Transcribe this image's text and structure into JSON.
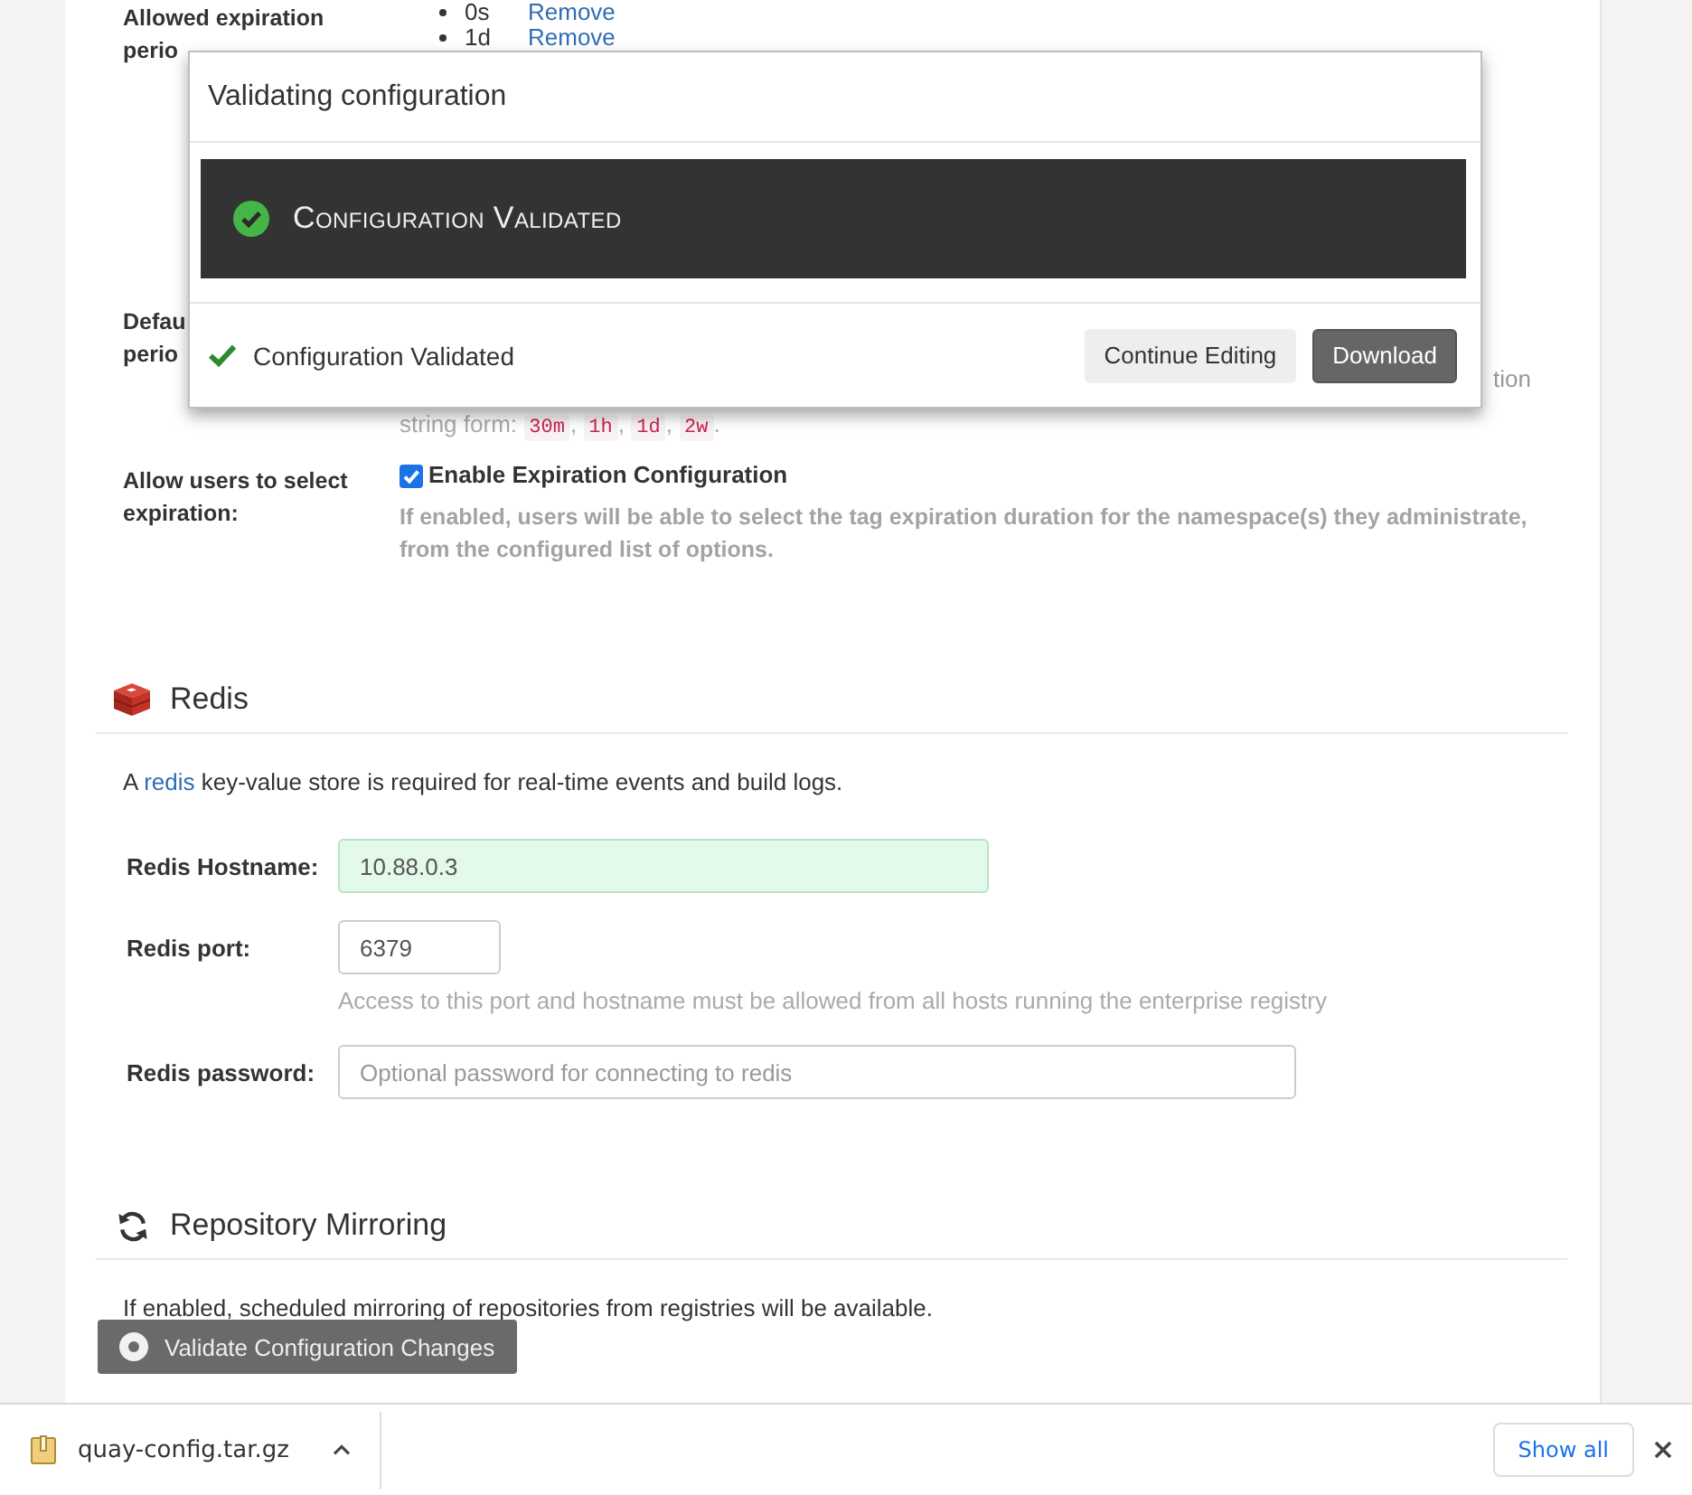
{
  "expiration_settings": {
    "rows": [
      {
        "kind": "list",
        "label_lines": [
          "Allowed expiration",
          "perio"
        ],
        "items": [
          {
            "value": "0s",
            "action": "Remove"
          },
          {
            "value": "1d",
            "action": "Remove"
          }
        ]
      },
      {
        "kind": "hint",
        "label_lines": [
          "Defau",
          "perio"
        ],
        "help_tail": "tion",
        "example": [
          {
            "kind": "plain",
            "text": "string form: "
          },
          {
            "kind": "code",
            "text": "30m"
          },
          {
            "kind": "plain",
            "text": ", "
          },
          {
            "kind": "code",
            "text": "1h"
          },
          {
            "kind": "plain",
            "text": ", "
          },
          {
            "kind": "code",
            "text": "1d"
          },
          {
            "kind": "plain",
            "text": ", "
          },
          {
            "kind": "code",
            "text": "2w"
          },
          {
            "kind": "plain",
            "text": "."
          }
        ]
      },
      {
        "kind": "checkbox",
        "label_lines": [
          "Allow users to select",
          "expiration:"
        ],
        "checkbox": {
          "label": "Enable Expiration Configuration",
          "checked": true
        },
        "help": "If enabled, users will be able to select the tag expiration duration for the namespace(s) they administrate, from the configured list of options."
      }
    ]
  },
  "redis": {
    "title": "Redis",
    "description": {
      "before": "A ",
      "link": "redis",
      "after": " key-value store is required for real-time events and build logs."
    },
    "fields": [
      {
        "label": "Redis Hostname:",
        "value": "10.88.0.3",
        "valid": true
      },
      {
        "label": "Redis port:",
        "value": "6379",
        "valid": false,
        "help": "Access to this port and hostname must be allowed from all hosts running the enterprise registry"
      },
      {
        "label": "Redis password:",
        "placeholder": "Optional password for connecting to redis",
        "valid": false
      }
    ]
  },
  "repository_mirroring": {
    "title": "Repository Mirroring",
    "description": "If enabled, scheduled mirroring of repositories from registries will be available."
  },
  "validate_button": {
    "label": "Validate Configuration Changes"
  },
  "modal": {
    "title": "Validating configuration",
    "validated": true,
    "banner": "Configuration Validated",
    "status": "Configuration Validated",
    "buttons": [
      {
        "label": "Continue Editing",
        "kind": "secondary"
      },
      {
        "label": "Download",
        "kind": "primary"
      }
    ]
  },
  "download_bar": {
    "file_name": "quay-config.tar.gz",
    "show_all": "Show all"
  }
}
